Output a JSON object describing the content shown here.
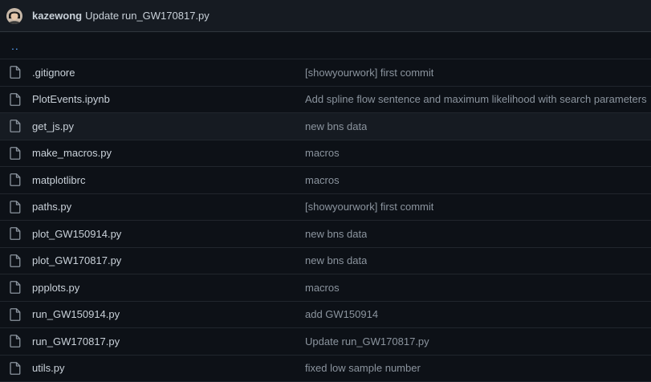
{
  "header": {
    "author": "kazewong",
    "message": "Update run_GW170817.py"
  },
  "up_link": "..",
  "files": [
    {
      "name": ".gitignore",
      "commit": "[showyourwork] first commit"
    },
    {
      "name": "PlotEvents.ipynb",
      "commit": "Add spline flow sentence and maximum likelihood with search parameters"
    },
    {
      "name": "get_js.py",
      "commit": "new bns data"
    },
    {
      "name": "make_macros.py",
      "commit": "macros"
    },
    {
      "name": "matplotlibrc",
      "commit": "macros"
    },
    {
      "name": "paths.py",
      "commit": "[showyourwork] first commit"
    },
    {
      "name": "plot_GW150914.py",
      "commit": "new bns data"
    },
    {
      "name": "plot_GW170817.py",
      "commit": "new bns data"
    },
    {
      "name": "ppplots.py",
      "commit": "macros"
    },
    {
      "name": "run_GW150914.py",
      "commit": "add GW150914"
    },
    {
      "name": "run_GW170817.py",
      "commit": "Update run_GW170817.py"
    },
    {
      "name": "utils.py",
      "commit": "fixed low sample number"
    }
  ],
  "highlighted_row_index": 2,
  "colors": {
    "background": "#0d1117",
    "header_background": "#161b22",
    "link": "#58a6ff",
    "muted_text": "#8b949e",
    "border": "#21262d"
  },
  "icons": {
    "file": "file-icon",
    "avatar": "avatar"
  }
}
